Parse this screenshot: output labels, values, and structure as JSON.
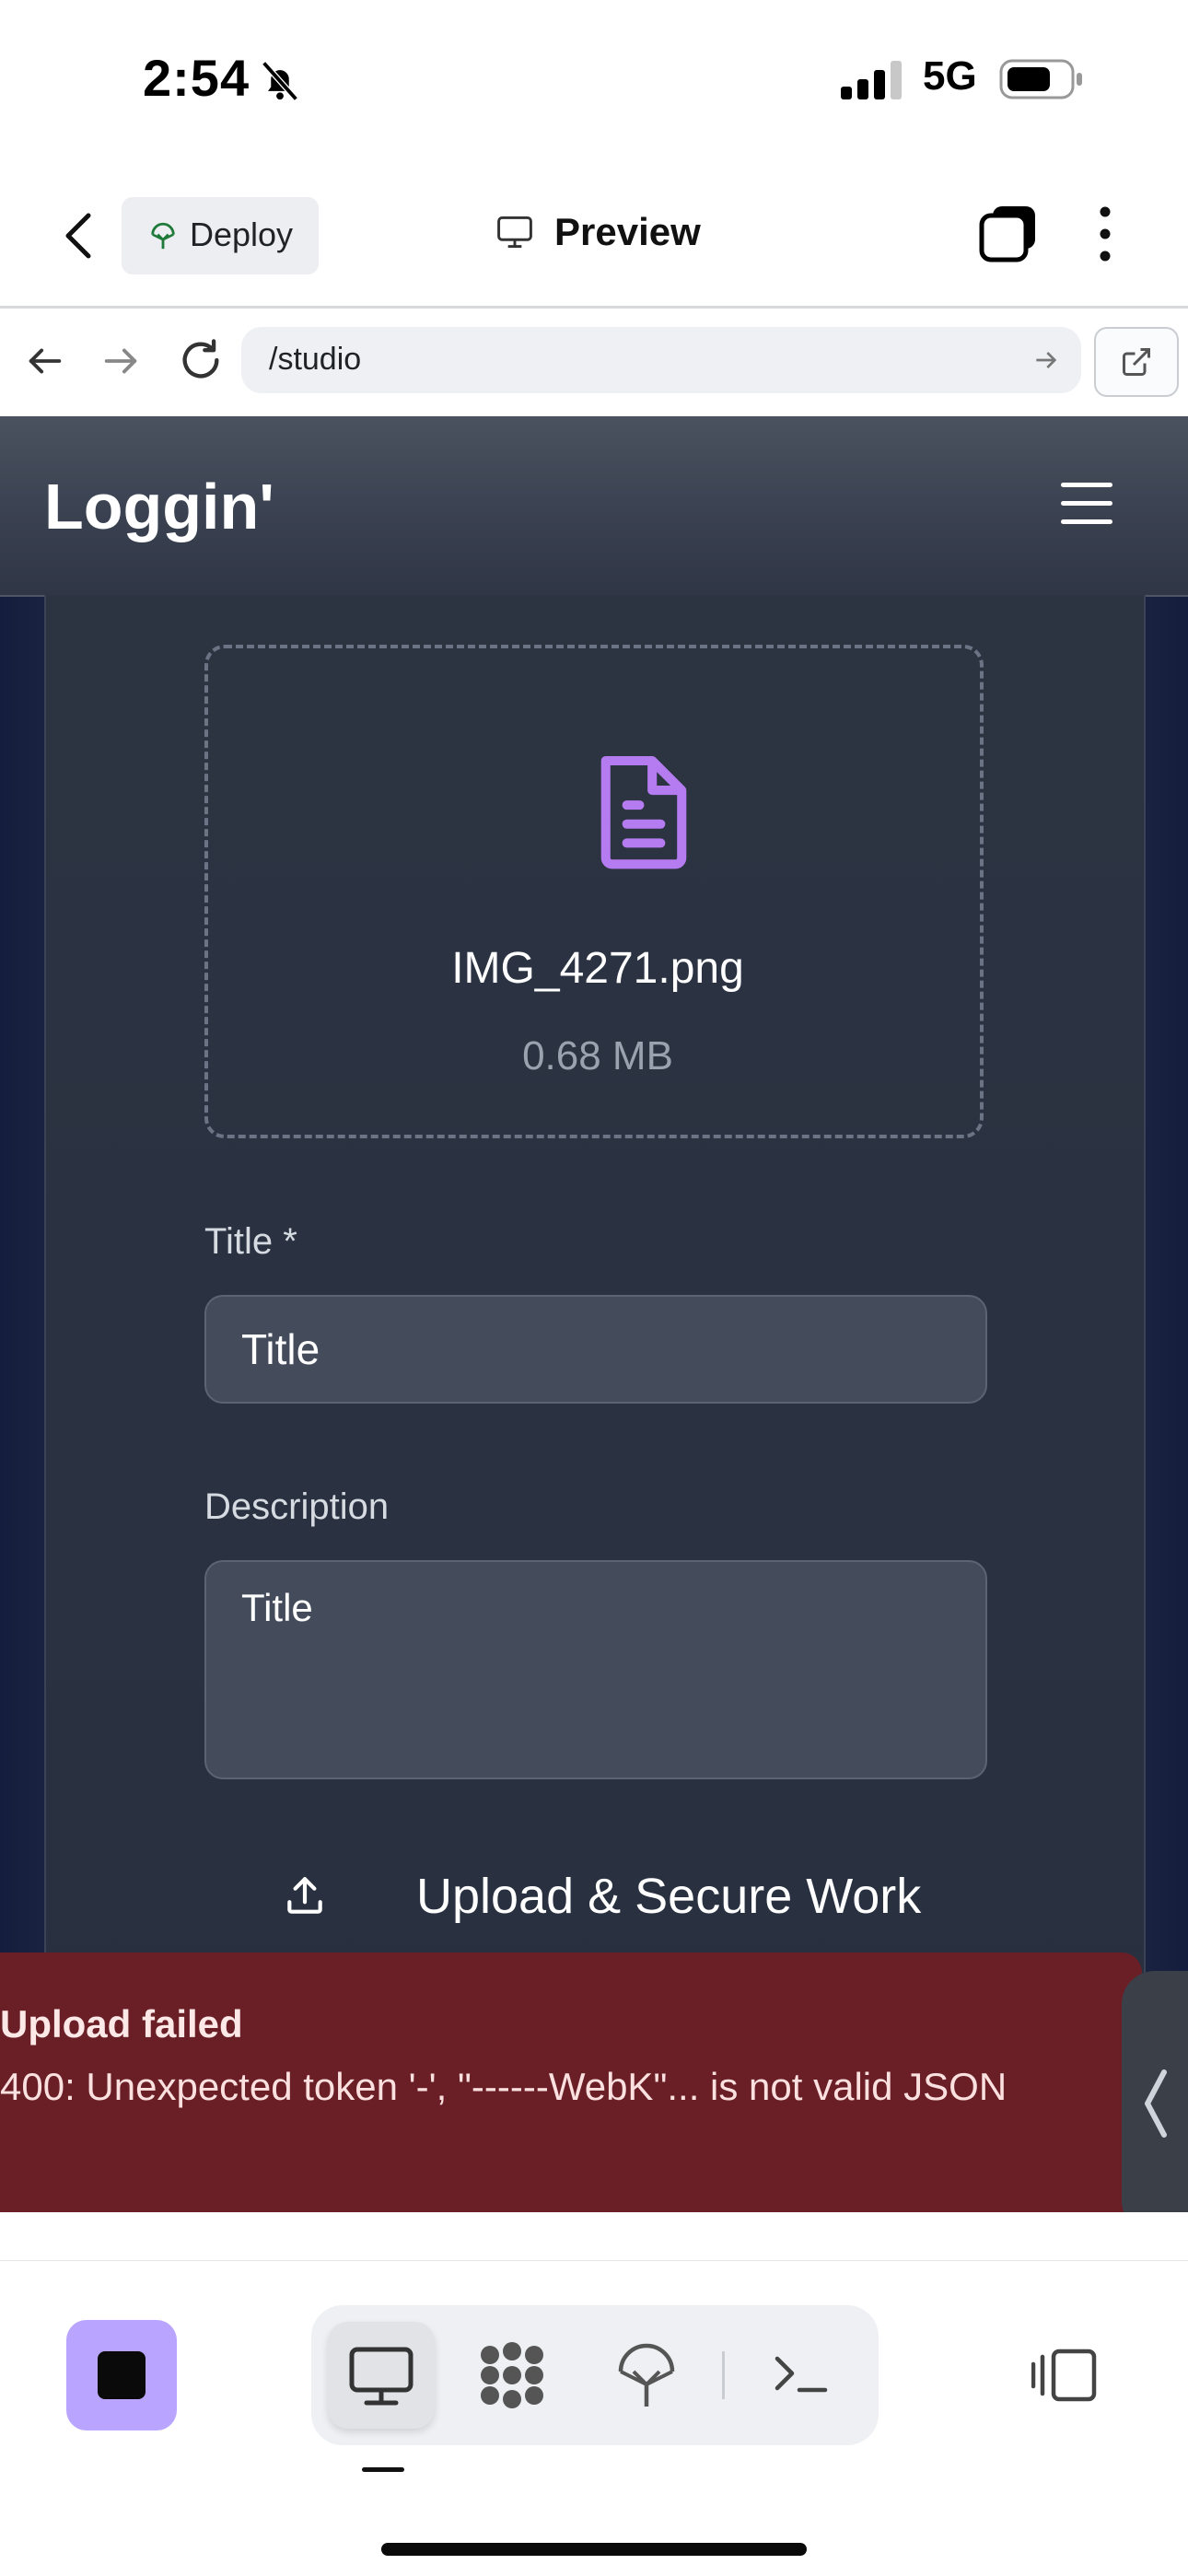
{
  "status_bar": {
    "time": "2:54",
    "network": "5G"
  },
  "app_nav": {
    "deploy_label": "Deploy",
    "preview_label": "Preview"
  },
  "url_bar": {
    "url": "/studio"
  },
  "site": {
    "logo": "Loggin'",
    "upload": {
      "file_name": "IMG_4271.png",
      "file_size": "0.68 MB",
      "title_label": "Title *",
      "title_value": "Title",
      "description_label": "Description",
      "description_value": "Title",
      "submit_label": "Upload & Secure Work"
    },
    "toast": {
      "title": "Upload failed",
      "message": "400: Unexpected token '-', \"------WebK\"... is not valid JSON"
    }
  },
  "colors": {
    "accent": "#b9a5ff",
    "file_icon": "#b57bf0",
    "toast_bg": "#6a1f26"
  }
}
